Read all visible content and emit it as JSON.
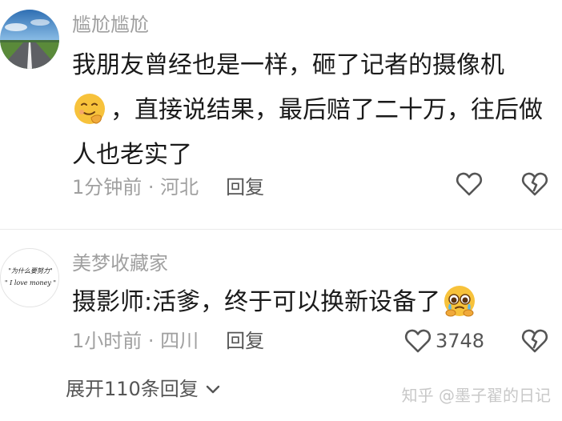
{
  "comments": [
    {
      "username": "尴尬尴尬",
      "text_line1": "我朋友曾经也是一样，砸了记者的摄像机",
      "text_line2_emoji": "smirk-face-emoji",
      "text_line2": "，直接说结果，最后赔了二十万，往后做",
      "text_line3": "人也老实了",
      "meta": "1分钟前 · 河北",
      "reply_label": "回复",
      "like_count": ""
    },
    {
      "username": "美梦收藏家",
      "avatar_text_line1": "\"为什么要努力\"",
      "avatar_text_line2": "\" I love money \"",
      "text": "摄影师:活爹，终于可以换新设备了",
      "text_emoji": "pleading-tears-face-emoji",
      "meta": "1小时前 · 四川",
      "reply_label": "回复",
      "like_count": "3748"
    }
  ],
  "expand_replies": "展开110条回复",
  "watermark": "知乎 @墨子翟的日记",
  "colors": {
    "meta_gray": "#a0a0a0",
    "text_dark": "#1a1a1a",
    "icon_gray": "#555555",
    "divider": "#ebebeb"
  }
}
